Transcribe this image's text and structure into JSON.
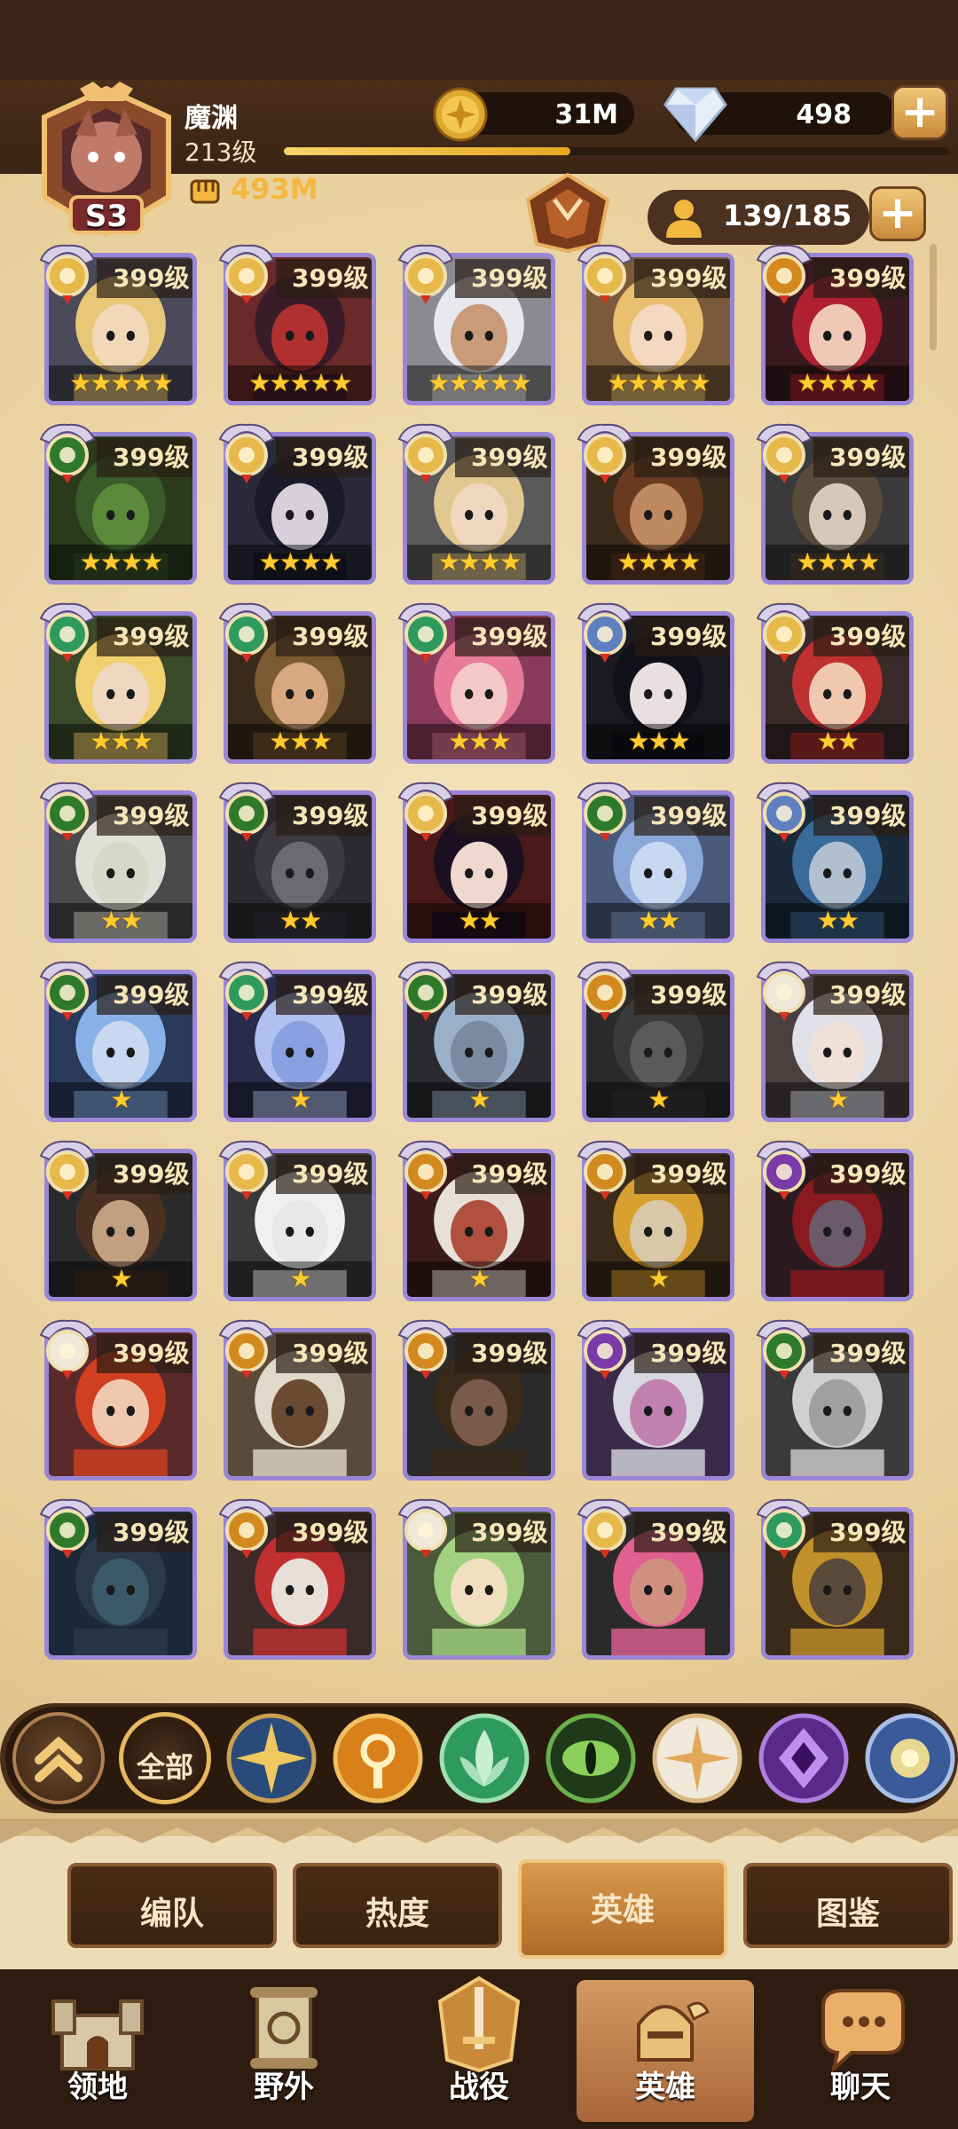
{
  "player": {
    "name": "魔渊",
    "level": "213级",
    "rank": "S3",
    "power": "493M"
  },
  "resources": {
    "gold": "31M",
    "diamonds": "498"
  },
  "hero_count": "139/185",
  "heroes": [
    {
      "level": "399级",
      "stars": "★★★★★",
      "faction": "lightbearer",
      "bg": "#4a4a5a",
      "face": "#f0d8b8",
      "hair": "#e8c878"
    },
    {
      "level": "399级",
      "stars": "★★★★★",
      "faction": "lightbearer",
      "bg": "#6a2a2a",
      "face": "#b03030",
      "hair": "#3a1c28"
    },
    {
      "level": "399级",
      "stars": "★★★★★",
      "faction": "lightbearer",
      "bg": "#8a8a90",
      "face": "#c99b7a",
      "hair": "#e8e8ee"
    },
    {
      "level": "399级",
      "stars": "★★★★★",
      "faction": "lightbearer",
      "bg": "#7a5a3a",
      "face": "#f4d8c0",
      "hair": "#e8c070"
    },
    {
      "level": "399级",
      "stars": "★★★★",
      "faction": "graveborn_gold",
      "bg": "#3a1a20",
      "face": "#f0c8b8",
      "hair": "#b02030"
    },
    {
      "level": "399级",
      "stars": "★★★★",
      "faction": "wilder",
      "bg": "#2a3a1a",
      "face": "#5a8a3a",
      "hair": "#3a5a2a"
    },
    {
      "level": "399级",
      "stars": "★★★★",
      "faction": "lightbearer",
      "bg": "#2a2a3a",
      "face": "#d8d0d8",
      "hair": "#1a1a2a"
    },
    {
      "level": "399级",
      "stars": "★★★★",
      "faction": "lightbearer",
      "bg": "#5a5a5a",
      "face": "#f0d8c0",
      "hair": "#e0c890"
    },
    {
      "level": "399级",
      "stars": "★★★★",
      "faction": "lightbearer",
      "bg": "#3a2a1a",
      "face": "#c08a60",
      "hair": "#6a3a20"
    },
    {
      "level": "399级",
      "stars": "★★★★",
      "faction": "lightbearer",
      "bg": "#3a3a3a",
      "face": "#d8c8b8",
      "hair": "#5a4a3a"
    },
    {
      "level": "399级",
      "stars": "★★★",
      "faction": "mauler",
      "bg": "#3a4a2a",
      "face": "#f0d8c0",
      "hair": "#f0d070"
    },
    {
      "level": "399级",
      "stars": "★★★",
      "faction": "mauler",
      "bg": "#3a2a1a",
      "face": "#d8a880",
      "hair": "#7a5a30"
    },
    {
      "level": "399级",
      "stars": "★★★",
      "faction": "mauler",
      "bg": "#8a3a5a",
      "face": "#f4c8c8",
      "hair": "#e87a9a"
    },
    {
      "level": "399级",
      "stars": "★★★",
      "faction": "dimensional",
      "bg": "#1a1a20",
      "face": "#e8e0e0",
      "hair": "#101018"
    },
    {
      "level": "399级",
      "stars": "★★",
      "faction": "lightbearer",
      "bg": "#3a2a2a",
      "face": "#f0c8b0",
      "hair": "#c03030"
    },
    {
      "level": "399级",
      "stars": "★★",
      "faction": "wilder",
      "bg": "#4a4a4a",
      "face": "#d8d8c8",
      "hair": "#e0e0d8"
    },
    {
      "level": "399级",
      "stars": "★★",
      "faction": "wilder",
      "bg": "#2a2a30",
      "face": "#6a6a70",
      "hair": "#3a3a40"
    },
    {
      "level": "399级",
      "stars": "★★",
      "faction": "lightbearer",
      "bg": "#4a1a1a",
      "face": "#f0d8d0",
      "hair": "#1a1020"
    },
    {
      "level": "399级",
      "stars": "★★",
      "faction": "wilder",
      "bg": "#4a5a7a",
      "face": "#c8d8f0",
      "hair": "#8aa8d8"
    },
    {
      "level": "399级",
      "stars": "★★",
      "faction": "dimensional",
      "bg": "#1a2a3a",
      "face": "#b0c0d0",
      "hair": "#3a6a9a"
    },
    {
      "level": "399级",
      "stars": "★",
      "faction": "wilder",
      "bg": "#2a3a5a",
      "face": "#c8d8f0",
      "hair": "#8ab0e8"
    },
    {
      "level": "399级",
      "stars": "★",
      "faction": "mauler",
      "bg": "#2a2a4a",
      "face": "#8aa0e0",
      "hair": "#b0c0f0"
    },
    {
      "level": "399级",
      "stars": "★",
      "faction": "wilder",
      "bg": "#2a2a30",
      "face": "#7a8aa0",
      "hair": "#9ab0c8"
    },
    {
      "level": "399级",
      "stars": "★",
      "faction": "graveborn_gold",
      "bg": "#2a2a2a",
      "face": "#5a5a5a",
      "hair": "#3a3a3a"
    },
    {
      "level": "399级",
      "stars": "★",
      "faction": "celestial",
      "bg": "#4a4040",
      "face": "#f0e0d8",
      "hair": "#e0e0e8"
    },
    {
      "level": "399级",
      "stars": "★",
      "faction": "lightbearer",
      "bg": "#2a2a2a",
      "face": "#c0a080",
      "hair": "#4a3020"
    },
    {
      "level": "399级",
      "stars": "★",
      "faction": "lightbearer",
      "bg": "#3a3a3a",
      "face": "#e8e8e8",
      "hair": "#f0f0f0"
    },
    {
      "level": "399级",
      "stars": "★",
      "faction": "graveborn_gold",
      "bg": "#3a1a1a",
      "face": "#b05040",
      "hair": "#e8e0d8"
    },
    {
      "level": "399级",
      "stars": "★",
      "faction": "graveborn_gold",
      "bg": "#3a2a1a",
      "face": "#d8c8a8",
      "hair": "#d8a030"
    },
    {
      "level": "399级",
      "stars": "",
      "faction": "hypogean",
      "bg": "#2a1a20",
      "face": "#6a5a6a",
      "hair": "#8a1a20"
    },
    {
      "level": "399级",
      "stars": "",
      "faction": "celestial",
      "bg": "#5a2a2a",
      "face": "#f0c8b0",
      "hair": "#d04020"
    },
    {
      "level": "399级",
      "stars": "",
      "faction": "graveborn_gold",
      "bg": "#5a4a3a",
      "face": "#6a4a30",
      "hair": "#e0d8c8"
    },
    {
      "level": "399级",
      "stars": "",
      "faction": "graveborn_gold",
      "bg": "#2a2a2a",
      "face": "#7a5a4a",
      "hair": "#3a2a1a"
    },
    {
      "level": "399级",
      "stars": "",
      "faction": "hypogean",
      "bg": "#3a2a4a",
      "face": "#c080b0",
      "hair": "#d8d8e0"
    },
    {
      "level": "399级",
      "stars": "",
      "faction": "wilder",
      "bg": "#3a3a3a",
      "face": "#a0a0a0",
      "hair": "#d0d0d0"
    },
    {
      "level": "399级",
      "stars": "",
      "faction": "wilder",
      "bg": "#1a2a3a",
      "face": "#3a5a6a",
      "hair": "#2a3a4a"
    },
    {
      "level": "399级",
      "stars": "",
      "faction": "graveborn_gold",
      "bg": "#3a2a2a",
      "face": "#e8e0d8",
      "hair": "#c03030"
    },
    {
      "level": "399级",
      "stars": "",
      "faction": "celestial",
      "bg": "#4a5a3a",
      "face": "#f0e0c0",
      "hair": "#a0d080"
    },
    {
      "level": "399级",
      "stars": "",
      "faction": "lightbearer",
      "bg": "#2a2a2a",
      "face": "#d09080",
      "hair": "#e06090"
    },
    {
      "level": "399级",
      "stars": "",
      "faction": "mauler",
      "bg": "#3a2a1a",
      "face": "#5a4a3a",
      "hair": "#c0902a"
    }
  ],
  "filters": {
    "all_label": "全部"
  },
  "tabs": [
    {
      "label": "编队"
    },
    {
      "label": "热度"
    },
    {
      "label": "英雄"
    },
    {
      "label": "图鉴"
    }
  ],
  "nav": [
    {
      "label": "领地"
    },
    {
      "label": "野外"
    },
    {
      "label": "战役"
    },
    {
      "label": "英雄"
    },
    {
      "label": "聊天"
    }
  ],
  "colors": {
    "lightbearer": "#e7b84a",
    "mauler": "#2f9a5e",
    "wilder": "#2f7a2a",
    "graveborn_gold": "#d28a1e",
    "celestial": "#f0e8d8",
    "hypogean": "#7a3aa8",
    "dimensional": "#5f7fbf"
  }
}
